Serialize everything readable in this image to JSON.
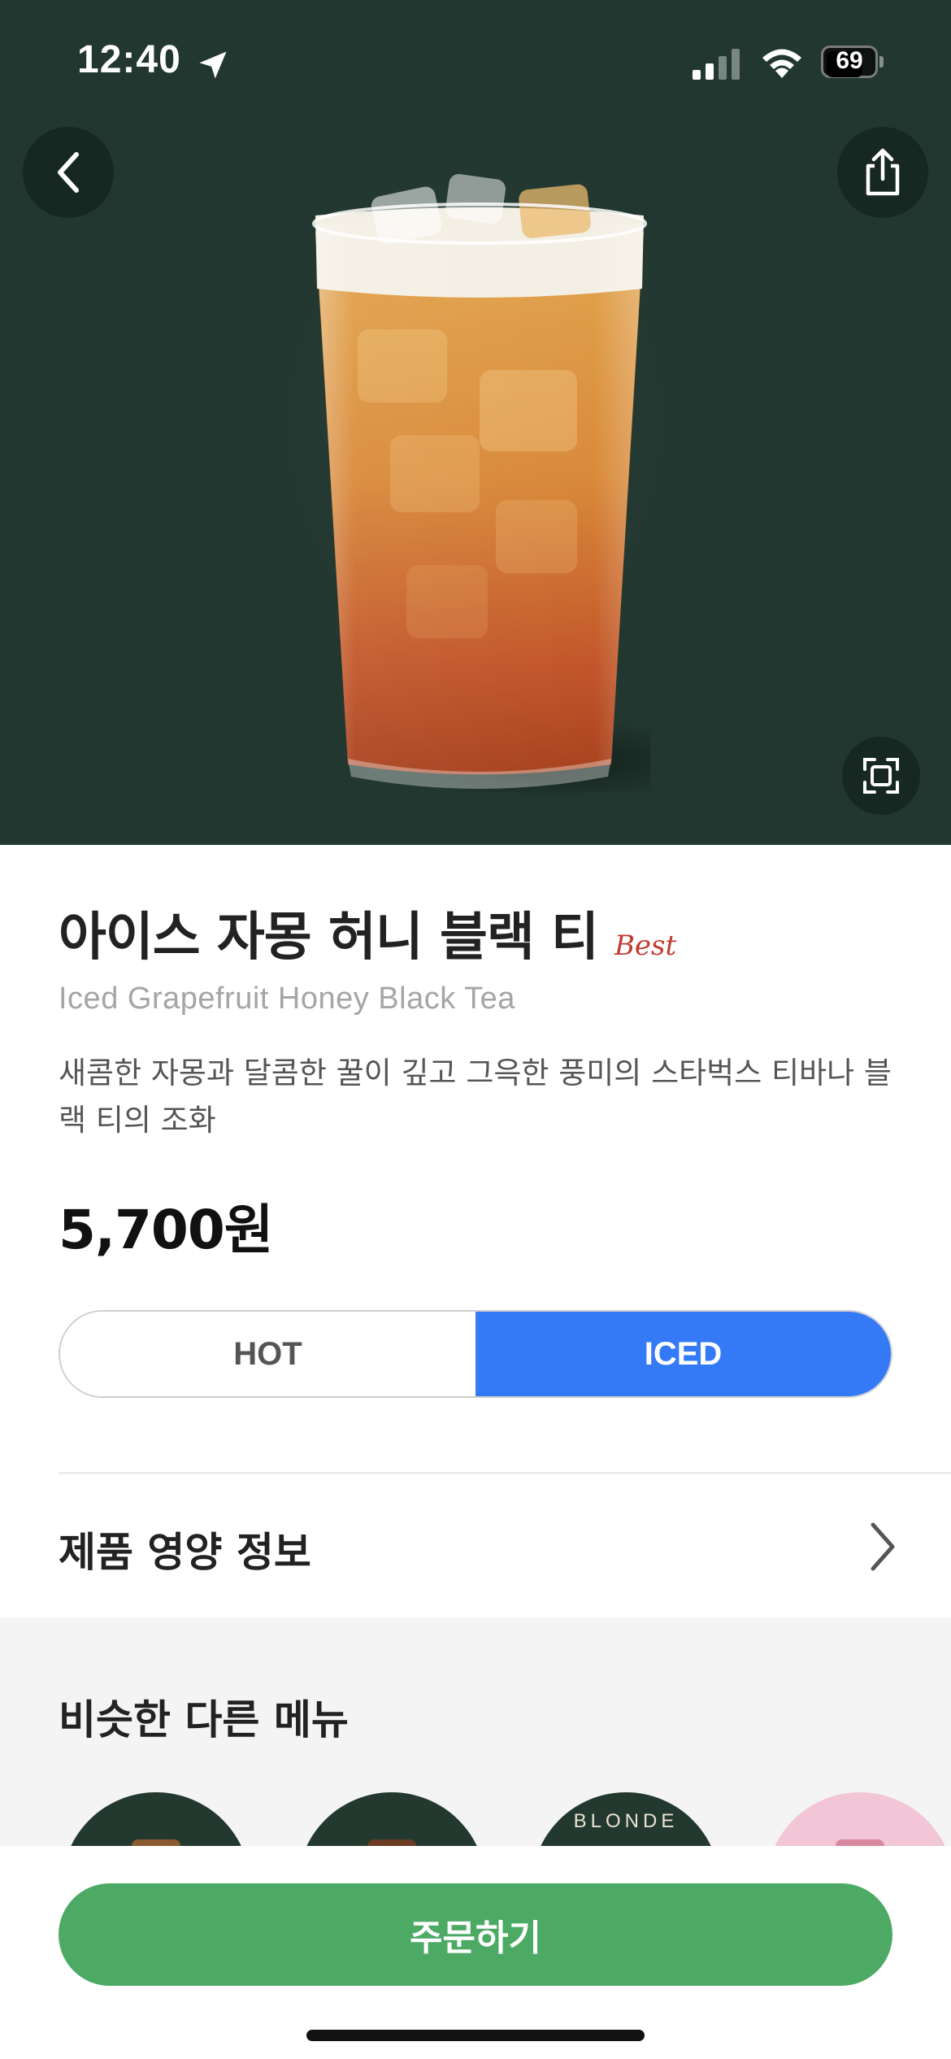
{
  "status_bar": {
    "time": "12:40",
    "battery": "69",
    "icons": [
      "location-arrow-icon",
      "cellular-signal-icon",
      "wifi-icon",
      "battery-icon"
    ]
  },
  "hero": {
    "background_color": "#21372f",
    "icons": [
      "chevron-left-icon",
      "share-icon",
      "expand-icon"
    ]
  },
  "product": {
    "name_ko": "아이스 자몽 허니 블랙 티",
    "badge": "Best",
    "name_en": "Iced Grapefruit Honey Black Tea",
    "description": "새콤한 자몽과 달콤한 꿀이 깊고 그윽한 풍미의 스타벅스 티바나 블랙 티의 조화",
    "price": "5,700원"
  },
  "temperature": {
    "options": [
      "HOT",
      "ICED"
    ],
    "selected": "ICED",
    "accent_color": "#3479f6"
  },
  "nutrition": {
    "label": "제품 영양 정보"
  },
  "similar": {
    "title": "비슷한 다른 메뉴",
    "thumb_3_text": "BLONDE"
  },
  "order": {
    "button_label": "주문하기",
    "button_color": "#4caa64"
  }
}
